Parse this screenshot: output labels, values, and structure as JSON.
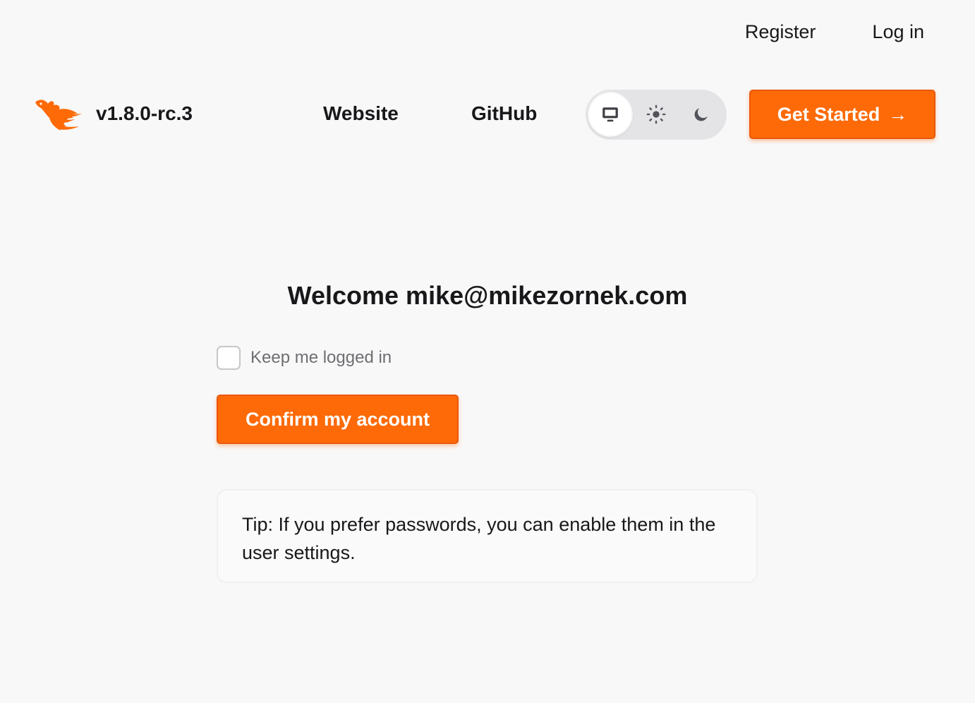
{
  "top_nav": {
    "register_label": "Register",
    "login_label": "Log in"
  },
  "header": {
    "version": "v1.8.0-rc.3",
    "website_label": "Website",
    "github_label": "GitHub",
    "theme_options": [
      "system",
      "light",
      "dark"
    ],
    "theme_selected": "system",
    "get_started_label": "Get Started",
    "get_started_arrow": "→"
  },
  "main": {
    "welcome_text": "Welcome mike@mikezornek.com",
    "keep_logged_in_label": "Keep me logged in",
    "keep_logged_in_checked": false,
    "confirm_button_label": "Confirm my account",
    "tip_text": "Tip: If you prefer passwords, you can enable them in the user settings."
  },
  "colors": {
    "accent": "#fd6a07",
    "background": "#f8f8f8",
    "text": "#18181b"
  }
}
